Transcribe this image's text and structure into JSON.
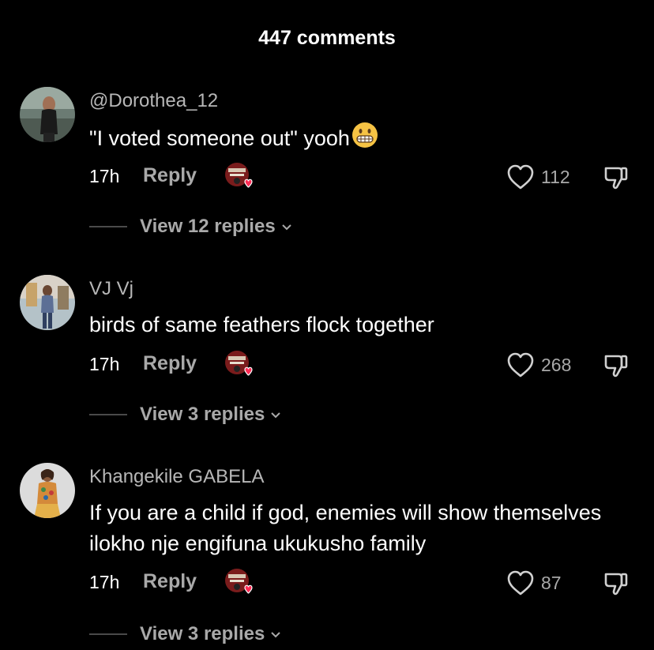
{
  "header": {
    "title": "447 comments"
  },
  "comments": [
    {
      "username": "@Dorothea_12",
      "text": "\"I voted someone out\" yooh",
      "emoji": "grimacing-face",
      "time": "17h",
      "reply_label": "Reply",
      "likes": "112",
      "view_replies": "View 12 replies"
    },
    {
      "username": "VJ Vj",
      "text": "birds of same feathers flock together",
      "time": "17h",
      "reply_label": "Reply",
      "likes": "268",
      "view_replies": "View 3 replies"
    },
    {
      "username": "Khangekile GABELA",
      "text": "If you are a child if god, enemies will show themselves ilokho nje engifuna ukukusho family",
      "time": "17h",
      "reply_label": "Reply",
      "likes": "87",
      "view_replies": "View 3 replies"
    }
  ],
  "icons": {
    "like": "heart-outline-icon",
    "dislike": "thumbs-down-icon",
    "creator_like": "creator-liked-badge-icon",
    "expand": "chevron-down-icon"
  },
  "colors": {
    "background": "#000000",
    "muted_text": "#a9a9a9",
    "heart_badge": "#fe2c55"
  }
}
